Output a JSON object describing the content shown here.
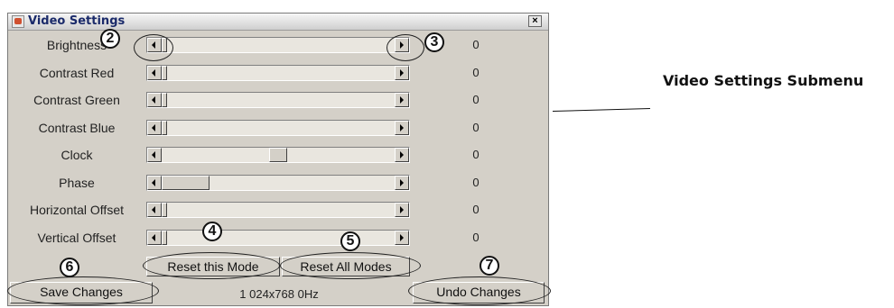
{
  "dialog": {
    "title": "Video Settings",
    "close_label": "×"
  },
  "settings": [
    {
      "label": "Brightness",
      "value": "0",
      "level": 0
    },
    {
      "label": "Contrast Red",
      "value": "0",
      "level": 0
    },
    {
      "label": "Contrast Green",
      "value": "0",
      "level": 0
    },
    {
      "label": "Contrast Blue",
      "value": "0",
      "level": 0
    },
    {
      "label": "Clock",
      "value": "0",
      "level": 0.5
    },
    {
      "label": "Phase",
      "value": "0",
      "level": 0.22
    },
    {
      "label": "Horizontal Offset",
      "value": "0",
      "level": 0
    },
    {
      "label": "Vertical Offset",
      "value": "0",
      "level": 0
    }
  ],
  "buttons": {
    "reset_mode": "Reset this Mode",
    "reset_all": "Reset All Modes",
    "save": "Save Changes",
    "undo": "Undo Changes"
  },
  "status": "1 024x768 0Hz",
  "callouts": [
    "2",
    "3",
    "4",
    "5",
    "6",
    "7"
  ],
  "caption": "Video Settings Submenu"
}
